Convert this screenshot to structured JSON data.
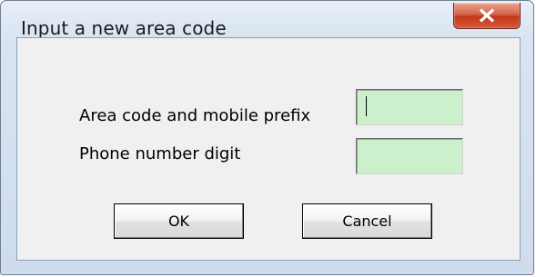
{
  "window": {
    "title": "Input a new area code",
    "close_icon": "close-icon"
  },
  "form": {
    "area_code_label": "Area code and mobile prefix",
    "area_code_value": "",
    "phone_digit_label": "Phone number digit",
    "phone_digit_value": ""
  },
  "buttons": {
    "ok_label": "OK",
    "cancel_label": "Cancel"
  },
  "colors": {
    "field_background": "#ccefcc",
    "close_button": "#c5361a",
    "dialog_background": "#f0f0f0"
  }
}
